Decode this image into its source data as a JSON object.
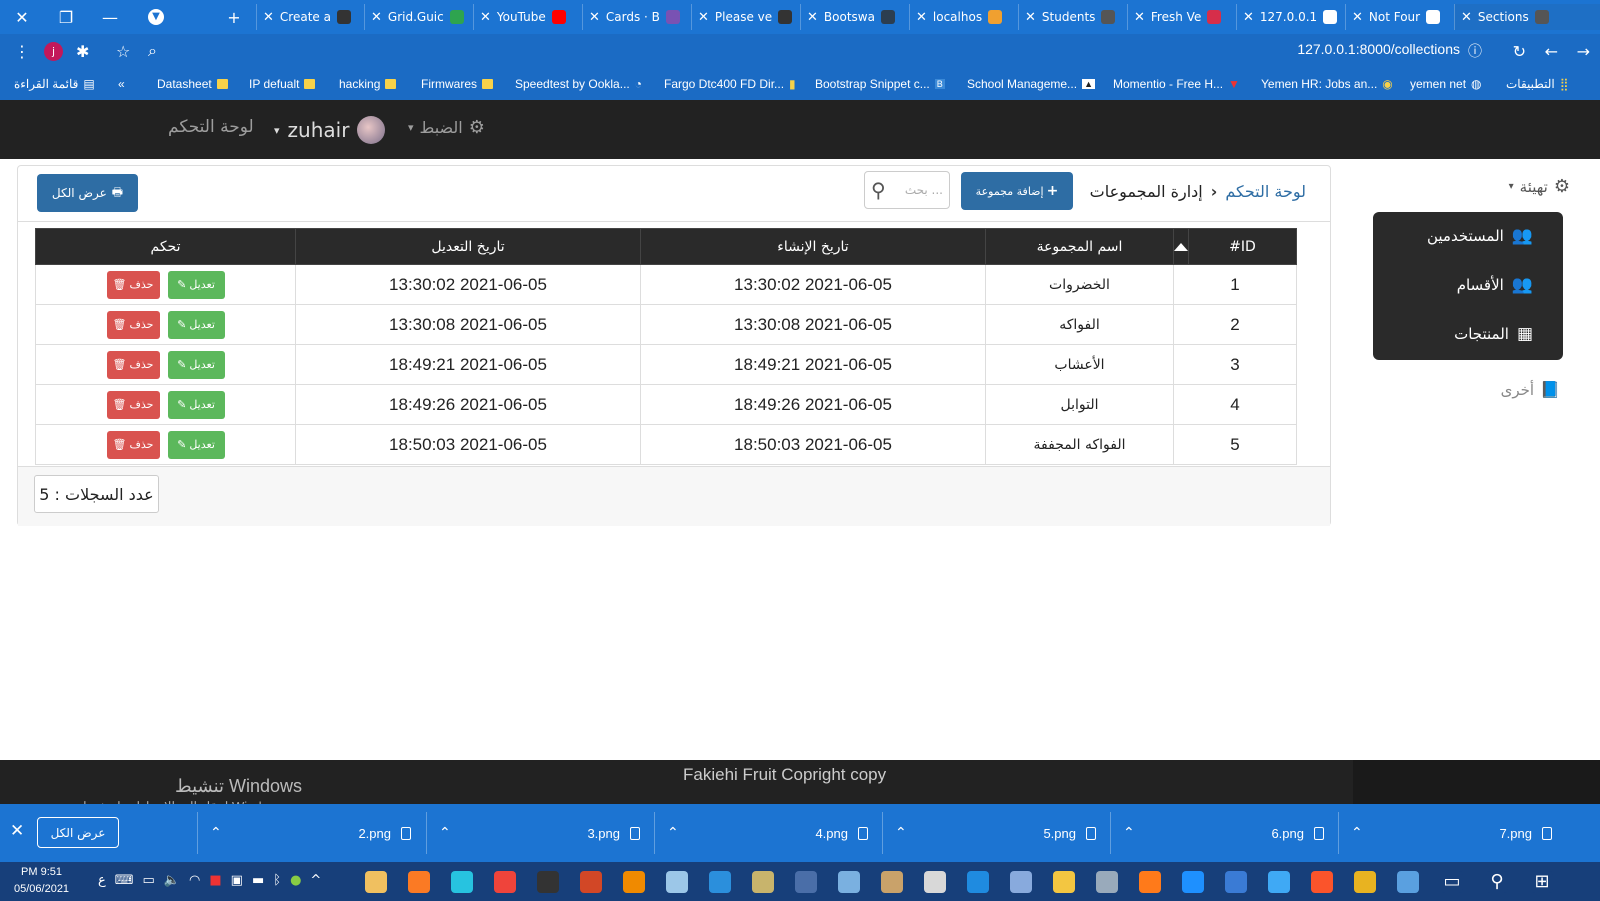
{
  "browser": {
    "tabs": [
      {
        "title": "Create a",
        "color": "#333333"
      },
      {
        "title": "Grid.Guic",
        "color": "#2ea44f"
      },
      {
        "title": "YouTube",
        "color": "#ff0000"
      },
      {
        "title": "Cards · B",
        "color": "#7952b3"
      },
      {
        "title": "Please ve",
        "color": "#333333"
      },
      {
        "title": "Bootswa",
        "color": "#2c3e50"
      },
      {
        "title": "localhos",
        "color": "#f0a030"
      },
      {
        "title": "Students",
        "color": "#555555"
      },
      {
        "title": "Fresh Ve",
        "color": "#d62e4a"
      },
      {
        "title": "127.0.0.1",
        "color": "#ffffff"
      },
      {
        "title": "Not Four",
        "color": "#ffffff"
      },
      {
        "title": "Sections",
        "color": "#555555"
      }
    ],
    "url": "127.0.0.1:8000/collections",
    "profile_initial": "j",
    "bookmarks": [
      {
        "label": "قائمة القراءة",
        "type": "reading"
      },
      {
        "label": "Datasheet",
        "type": "folder"
      },
      {
        "label": "IP defualt",
        "type": "folder"
      },
      {
        "label": "hacking",
        "type": "folder"
      },
      {
        "label": "Firmwares",
        "type": "folder"
      },
      {
        "label": "Speedtest by Ookla...",
        "type": "site"
      },
      {
        "label": "Fargo Dtc400 FD Dir...",
        "type": "site"
      },
      {
        "label": "Bootstrap Snippet c...",
        "type": "site"
      },
      {
        "label": "School Manageme...",
        "type": "site"
      },
      {
        "label": "Momentio - Free H...",
        "type": "site"
      },
      {
        "label": "Yemen HR: Jobs an...",
        "type": "site"
      },
      {
        "label": "yemen net",
        "type": "site"
      },
      {
        "label": "التطبيقات",
        "type": "apps"
      }
    ]
  },
  "navbar": {
    "dashboard": "لوحة التحكم",
    "username": "zuhair",
    "settings": "الضبط"
  },
  "sidebar": {
    "config": "تهيئة",
    "items": [
      {
        "label": "المستخدمين",
        "icon": "users-icon"
      },
      {
        "label": "الأقسام",
        "icon": "users-icon"
      },
      {
        "label": "المنتجات",
        "icon": "calendar-icon"
      }
    ],
    "other": "أخرى"
  },
  "page": {
    "breadcrumb_home": "لوحة التحكم",
    "breadcrumb_current": "إدارة المجموعات",
    "add_button": "إضافة مجموعة",
    "search_placeholder": "بحث ...",
    "print_button": "عرض الكل",
    "count_label": "عدد السجلات : 5"
  },
  "table": {
    "headers": [
      "ID#",
      "اسم المجموعة",
      "تاريخ الإنشاء",
      "تاريخ التعديل",
      "تحكم"
    ],
    "edit_label": "تعديل",
    "delete_label": "حذف",
    "rows": [
      {
        "id": "1",
        "name": "الخضروات",
        "created": "2021-06-05 13:30:02",
        "updated": "2021-06-05 13:30:02"
      },
      {
        "id": "2",
        "name": "الفواكه",
        "created": "2021-06-05 13:30:08",
        "updated": "2021-06-05 13:30:08"
      },
      {
        "id": "3",
        "name": "الأعشاب",
        "created": "2021-06-05 18:49:21",
        "updated": "2021-06-05 18:49:21"
      },
      {
        "id": "4",
        "name": "التوابل",
        "created": "2021-06-05 18:49:26",
        "updated": "2021-06-05 18:49:26"
      },
      {
        "id": "5",
        "name": "الفواكه المجففة",
        "created": "2021-06-05 18:50:03",
        "updated": "2021-06-05 18:50:03"
      }
    ]
  },
  "footer": {
    "copyright": "Fakiehi Fruit Copright copy",
    "activate_title": "تنشيط Windows",
    "activate_sub": "انتقل إلى الإعدادات لتنشيط Windows."
  },
  "downloads": {
    "show_all": "عرض الكل",
    "files": [
      "7.png",
      "6.png",
      "5.png",
      "4.png",
      "3.png",
      "2.png"
    ]
  },
  "taskbar": {
    "time": "PM 9:51",
    "date": "05/06/2021",
    "lang": "ع"
  },
  "colors": {
    "chrome_blue": "#1c74d2",
    "navbar": "#222222",
    "primary": "#2e6da4",
    "success": "#5cb85c",
    "danger": "#d9534f"
  }
}
